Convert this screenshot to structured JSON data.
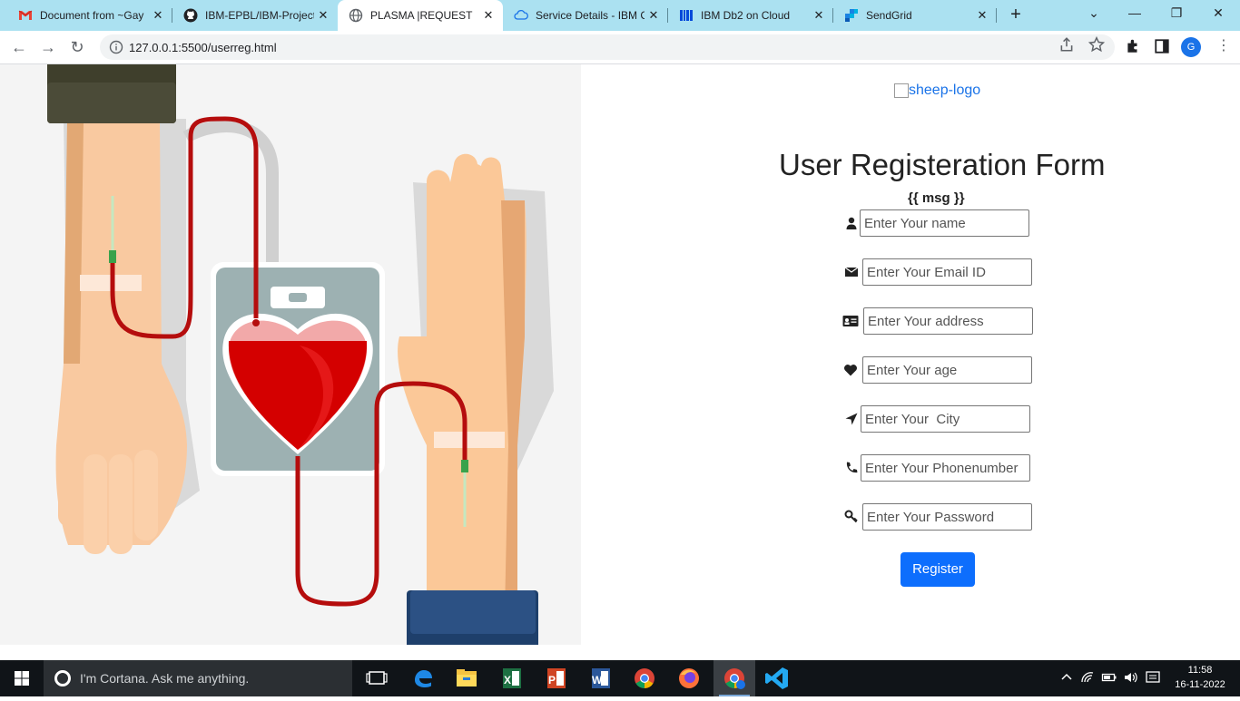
{
  "tabs": [
    {
      "title": "Document from ~Gay",
      "icon": "gmail-icon"
    },
    {
      "title": "IBM-EPBL/IBM-Project",
      "icon": "github-icon"
    },
    {
      "title": "PLASMA |REQUEST",
      "icon": "globe-icon"
    },
    {
      "title": "Service Details - IBM C",
      "icon": "cloud-icon"
    },
    {
      "title": "IBM Db2 on Cloud",
      "icon": "db2-icon"
    },
    {
      "title": "SendGrid",
      "icon": "sendgrid-icon"
    }
  ],
  "active_tab_index": 2,
  "address_bar": {
    "url": "127.0.0.1:5500/userreg.html"
  },
  "profile_initial": "G",
  "page": {
    "logo_alt": "sheep-logo",
    "form_title": "User Registeration Form",
    "msg": "{{ msg }}",
    "fields": [
      {
        "name": "name",
        "icon": "user-icon",
        "placeholder": "Enter Your name",
        "type": "text"
      },
      {
        "name": "email",
        "icon": "envelope-icon",
        "placeholder": "Enter Your Email ID",
        "type": "text"
      },
      {
        "name": "address",
        "icon": "id-card-icon",
        "placeholder": "Enter Your address",
        "type": "text"
      },
      {
        "name": "age",
        "icon": "heart-icon",
        "placeholder": "Enter Your age",
        "type": "text"
      },
      {
        "name": "city",
        "icon": "location-arrow-icon",
        "placeholder": "Enter Your  City",
        "type": "text"
      },
      {
        "name": "phone",
        "icon": "phone-icon",
        "placeholder": "Enter Your Phonenumber",
        "type": "text"
      },
      {
        "name": "password",
        "icon": "key-icon",
        "placeholder": "Enter Your Password",
        "type": "password"
      }
    ],
    "register_label": "Register"
  },
  "taskbar": {
    "cortana_text": "I'm Cortana. Ask me anything.",
    "apps": [
      "task-view-icon",
      "edge-icon",
      "file-explorer-icon",
      "excel-icon",
      "powerpoint-icon",
      "word-icon",
      "chrome-icon",
      "firefox-icon",
      "chrome-profile-icon",
      "vscode-icon"
    ],
    "time": "11:58",
    "date": "16-11-2022"
  },
  "colors": {
    "tab_strip": "#abe1f1",
    "register_button": "#0d6efd",
    "blood_red": "#d40000",
    "taskbar": "#101418"
  }
}
